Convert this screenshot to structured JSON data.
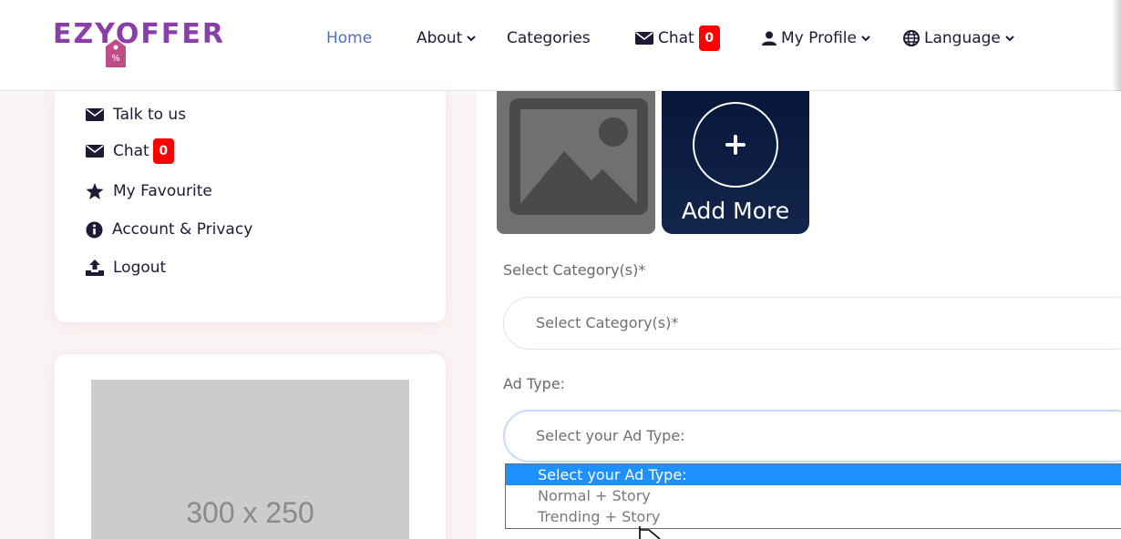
{
  "brand": {
    "name": "EZYOFFER"
  },
  "nav": {
    "home": "Home",
    "about": "About",
    "categories": "Categories",
    "chat": "Chat",
    "chat_count": "0",
    "profile": "My Profile",
    "language": "Language"
  },
  "sidebar": {
    "items": [
      {
        "label": "Talk to us",
        "icon": "envelope-icon"
      },
      {
        "label": "Chat",
        "icon": "envelope-icon",
        "badge": "0"
      },
      {
        "label": "My Favourite",
        "icon": "star-icon"
      },
      {
        "label": "Account & Privacy",
        "icon": "info-circle-icon"
      },
      {
        "label": "Logout",
        "icon": "upload-tray-icon"
      }
    ]
  },
  "ad_banner": {
    "size_label": "300 x 250"
  },
  "main": {
    "add_more_label": "Add More",
    "category": {
      "label": "Select Category(s)*",
      "placeholder": "Select Category(s)*"
    },
    "ad_type": {
      "label": "Ad Type:",
      "selected": "Select your Ad Type:",
      "options": [
        "Select your Ad Type:",
        "Normal + Story",
        "Trending + Story"
      ]
    }
  },
  "colors": {
    "accent": "#4f6fbf",
    "brand_purple": "#8a3ea8",
    "badge_red": "#ff0000",
    "dark_navy": "#06173a",
    "dropdown_selected": "#1e90ff"
  }
}
